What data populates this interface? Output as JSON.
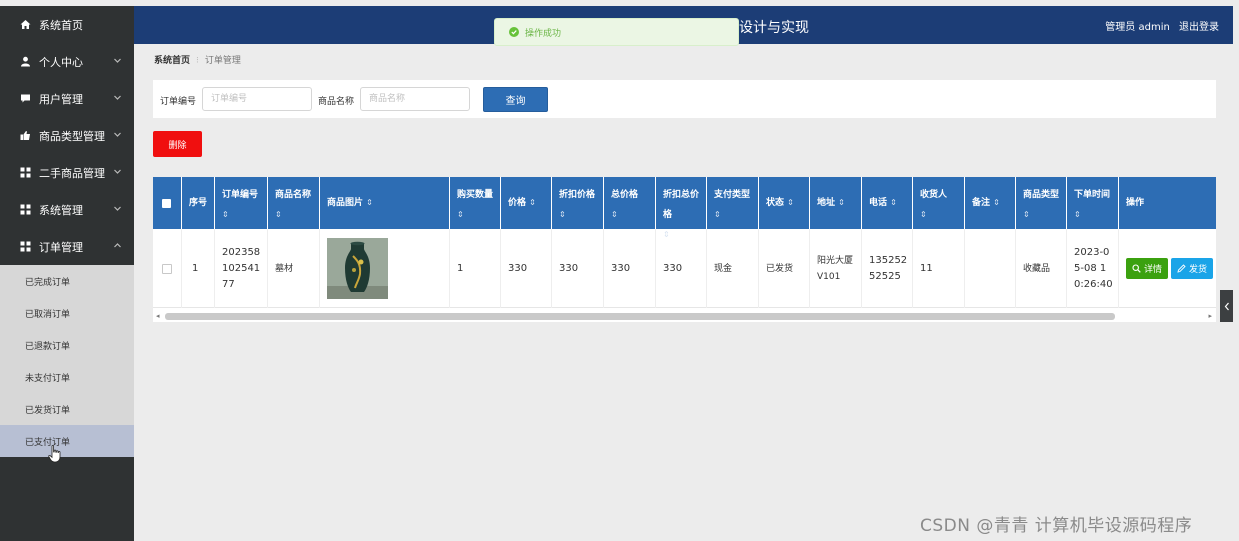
{
  "header": {
    "title": "设计与实现",
    "user_label": "管理员 admin",
    "logout_label": "退出登录"
  },
  "toast": {
    "message": "操作成功"
  },
  "sidebar": {
    "items": [
      {
        "label": "系统首页",
        "icon": "home-icon"
      },
      {
        "label": "个人中心",
        "icon": "user-icon"
      },
      {
        "label": "用户管理",
        "icon": "chat-icon"
      },
      {
        "label": "商品类型管理",
        "icon": "thumbs-up-icon"
      },
      {
        "label": "二手商品管理",
        "icon": "grid-icon"
      },
      {
        "label": "系统管理",
        "icon": "grid-icon"
      },
      {
        "label": "订单管理",
        "icon": "grid-icon"
      }
    ],
    "submenu": [
      {
        "label": "已完成订单"
      },
      {
        "label": "已取消订单"
      },
      {
        "label": "已退款订单"
      },
      {
        "label": "未支付订单"
      },
      {
        "label": "已发货订单"
      },
      {
        "label": "已支付订单"
      }
    ]
  },
  "breadcrumb": {
    "home": "系统首页",
    "current": "订单管理"
  },
  "search": {
    "order_no_label": "订单编号",
    "order_no_placeholder": "订单编号",
    "product_name_label": "商品名称",
    "product_name_placeholder": "商品名称",
    "query_button": "查询"
  },
  "actions": {
    "delete_button": "删除"
  },
  "table": {
    "headers": {
      "index": "序号",
      "order_no": "订单编号",
      "product_name": "商品名称",
      "product_image": "商品图片",
      "quantity": "购买数量",
      "price": "价格",
      "discount_price": "折扣价格",
      "total_price": "总价格",
      "discount_total": "折扣总价格",
      "payment_type": "支付类型",
      "status": "状态",
      "address": "地址",
      "phone": "电话",
      "receiver": "收货人",
      "remark": "备注",
      "product_type": "商品类型",
      "order_time": "下单时间",
      "actions": "操作"
    },
    "rows": [
      {
        "index": "1",
        "order_no": "20235810254177",
        "product_name": "墓材",
        "product_image": "vase",
        "quantity": "1",
        "price": "330",
        "discount_price": "330",
        "total_price": "330",
        "discount_total": "330",
        "payment_type": "现金",
        "status": "已发货",
        "address": "阳光大厦V101",
        "phone": "13525252525",
        "receiver": "11",
        "remark": "",
        "product_type": "收藏品",
        "order_time": "2023-05-08 10:26:40",
        "detail_button": "详情",
        "ship_button": "发货"
      }
    ]
  },
  "watermark": "CSDN @青青  计算机毕设源码程序",
  "colors": {
    "header_bg": "#1c3d76",
    "table_header_bg": "#2d6db4",
    "sidebar_bg": "#2f3233",
    "delete_red": "#f00f0f",
    "detail_green": "#3ba10f",
    "ship_blue": "#1aa4e8"
  }
}
